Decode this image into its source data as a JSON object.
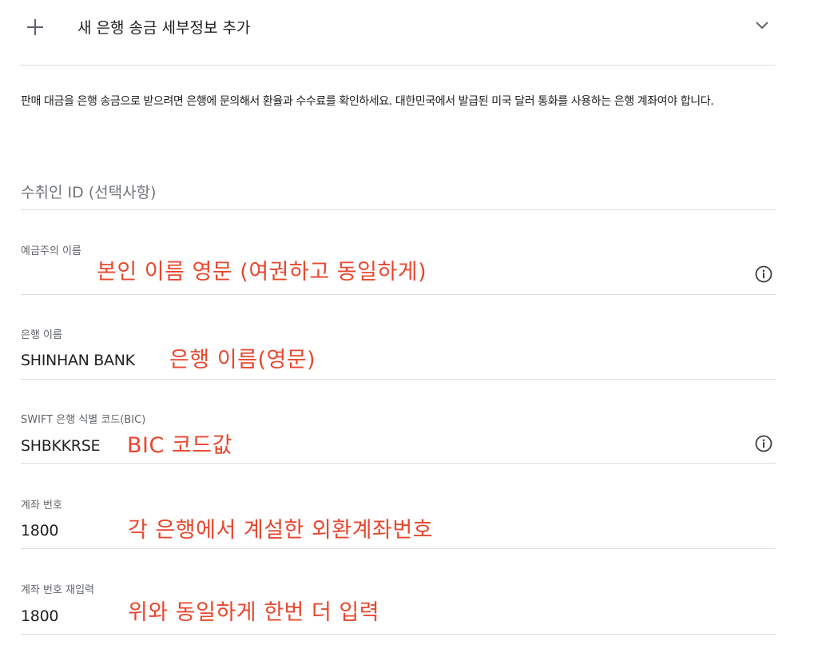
{
  "header": {
    "title": "새 은행 송금 세부정보 추가"
  },
  "description": "판매 대금을 은행 송금으로 받으려면 은행에 문의해서 환율과 수수료를 확인하세요. 대한민국에서 발급된 미국 달러 통화를 사용하는 은행 계좌여야 합니다.",
  "fields": {
    "payee_id": {
      "placeholder": "수취인 ID (선택사항)"
    },
    "account_holder": {
      "label": "예금주의 이름",
      "value": "",
      "annotation": "본인 이름 영문 (여권하고 동일하게)"
    },
    "bank_name": {
      "label": "은행 이름",
      "value": "SHINHAN BANK",
      "annotation": "은행 이름(영문)"
    },
    "swift": {
      "label": "SWIFT 은행 식별 코드(BIC)",
      "value": "SHBKKRSE",
      "annotation": "BIC 코드값"
    },
    "account_number": {
      "label": "계좌 번호",
      "value": "1800",
      "annotation": "각 은행에서 계설한 외환계좌번호"
    },
    "account_number_confirm": {
      "label": "계좌 번호 재입력",
      "value": "1800",
      "annotation": "위와 동일하게 한번 더 입력"
    }
  },
  "colors": {
    "annotation": "#e8472f",
    "divider": "#dadce0",
    "label": "#5f6368",
    "text": "#202124"
  },
  "icons": [
    "plus-icon",
    "chevron-down-icon",
    "info-icon"
  ]
}
